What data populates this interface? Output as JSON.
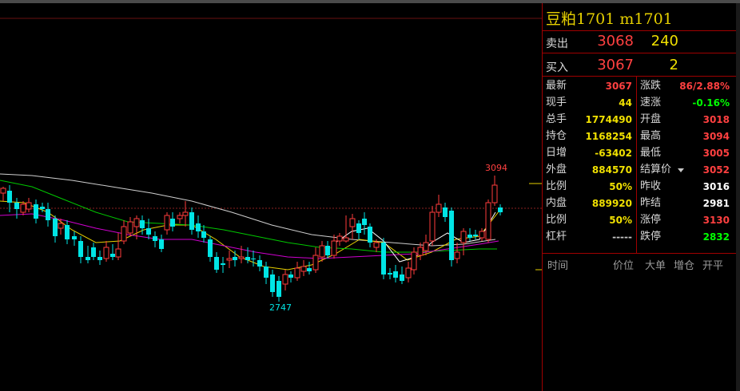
{
  "instrument": {
    "title": "豆粕1701  m1701"
  },
  "quote": {
    "sell": {
      "label": "卖出",
      "price": "3068",
      "volume": "240"
    },
    "buy": {
      "label": "买入",
      "price": "3067",
      "volume": "2"
    }
  },
  "stats": [
    {
      "l1": "最新",
      "v1": "3067",
      "c1": "#ff4040",
      "l2": "涨跌",
      "v2": "86/2.88%",
      "c2": "#ff4040"
    },
    {
      "l1": "现手",
      "v1": "44",
      "c1": "#f0e000",
      "l2": "速涨",
      "v2": "-0.16%",
      "c2": "#00ff00"
    },
    {
      "l1": "总手",
      "v1": "1774490",
      "c1": "#f0e000",
      "l2": "开盘",
      "v2": "3018",
      "c2": "#ff4040"
    },
    {
      "l1": "持仓",
      "v1": "1168254",
      "c1": "#f0e000",
      "l2": "最高",
      "v2": "3094",
      "c2": "#ff4040"
    },
    {
      "l1": "日增",
      "v1": "-63402",
      "c1": "#f0e000",
      "l2": "最低",
      "v2": "3005",
      "c2": "#ff4040"
    },
    {
      "l1": "外盘",
      "v1": "884570",
      "c1": "#f0e000",
      "l2": "结算价",
      "v2": "3052",
      "c2": "#ff4040"
    },
    {
      "l1": "比例",
      "v1": "50%",
      "c1": "#f0e000",
      "l2": "昨收",
      "v2": "3016",
      "c2": "#ffffff"
    },
    {
      "l1": "内盘",
      "v1": "889920",
      "c1": "#f0e000",
      "l2": "昨结",
      "v2": "2981",
      "c2": "#ffffff"
    },
    {
      "l1": "比例",
      "v1": "50%",
      "c1": "#f0e000",
      "l2": "涨停",
      "v2": "3130",
      "c2": "#ff4040"
    },
    {
      "l1": "杠杆",
      "v1": "-----",
      "c1": "#c8c8c8",
      "l2": "跌停",
      "v2": "2832",
      "c2": "#00ff00"
    }
  ],
  "tape_headers": [
    "时间",
    "价位",
    "大单",
    "增仓",
    "开平"
  ],
  "chart": {
    "high_label": "3094",
    "low_label": "2747",
    "colors": {
      "up": "#ff3c3c",
      "down": "#00e5e5"
    }
  }
}
